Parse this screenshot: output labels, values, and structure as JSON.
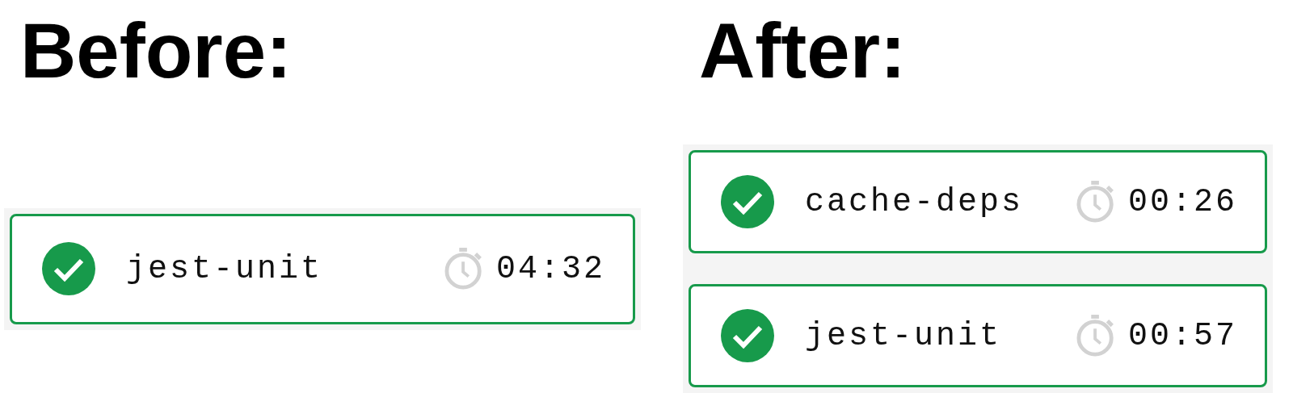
{
  "panels": [
    {
      "heading": "Before:",
      "jobs": [
        {
          "name": "jest-unit",
          "passed": true,
          "duration": "04:32"
        }
      ]
    },
    {
      "heading": "After:",
      "jobs": [
        {
          "name": "cache-deps",
          "passed": true,
          "duration": "00:26"
        },
        {
          "name": "jest-unit",
          "passed": true,
          "duration": "00:57"
        }
      ]
    }
  ]
}
